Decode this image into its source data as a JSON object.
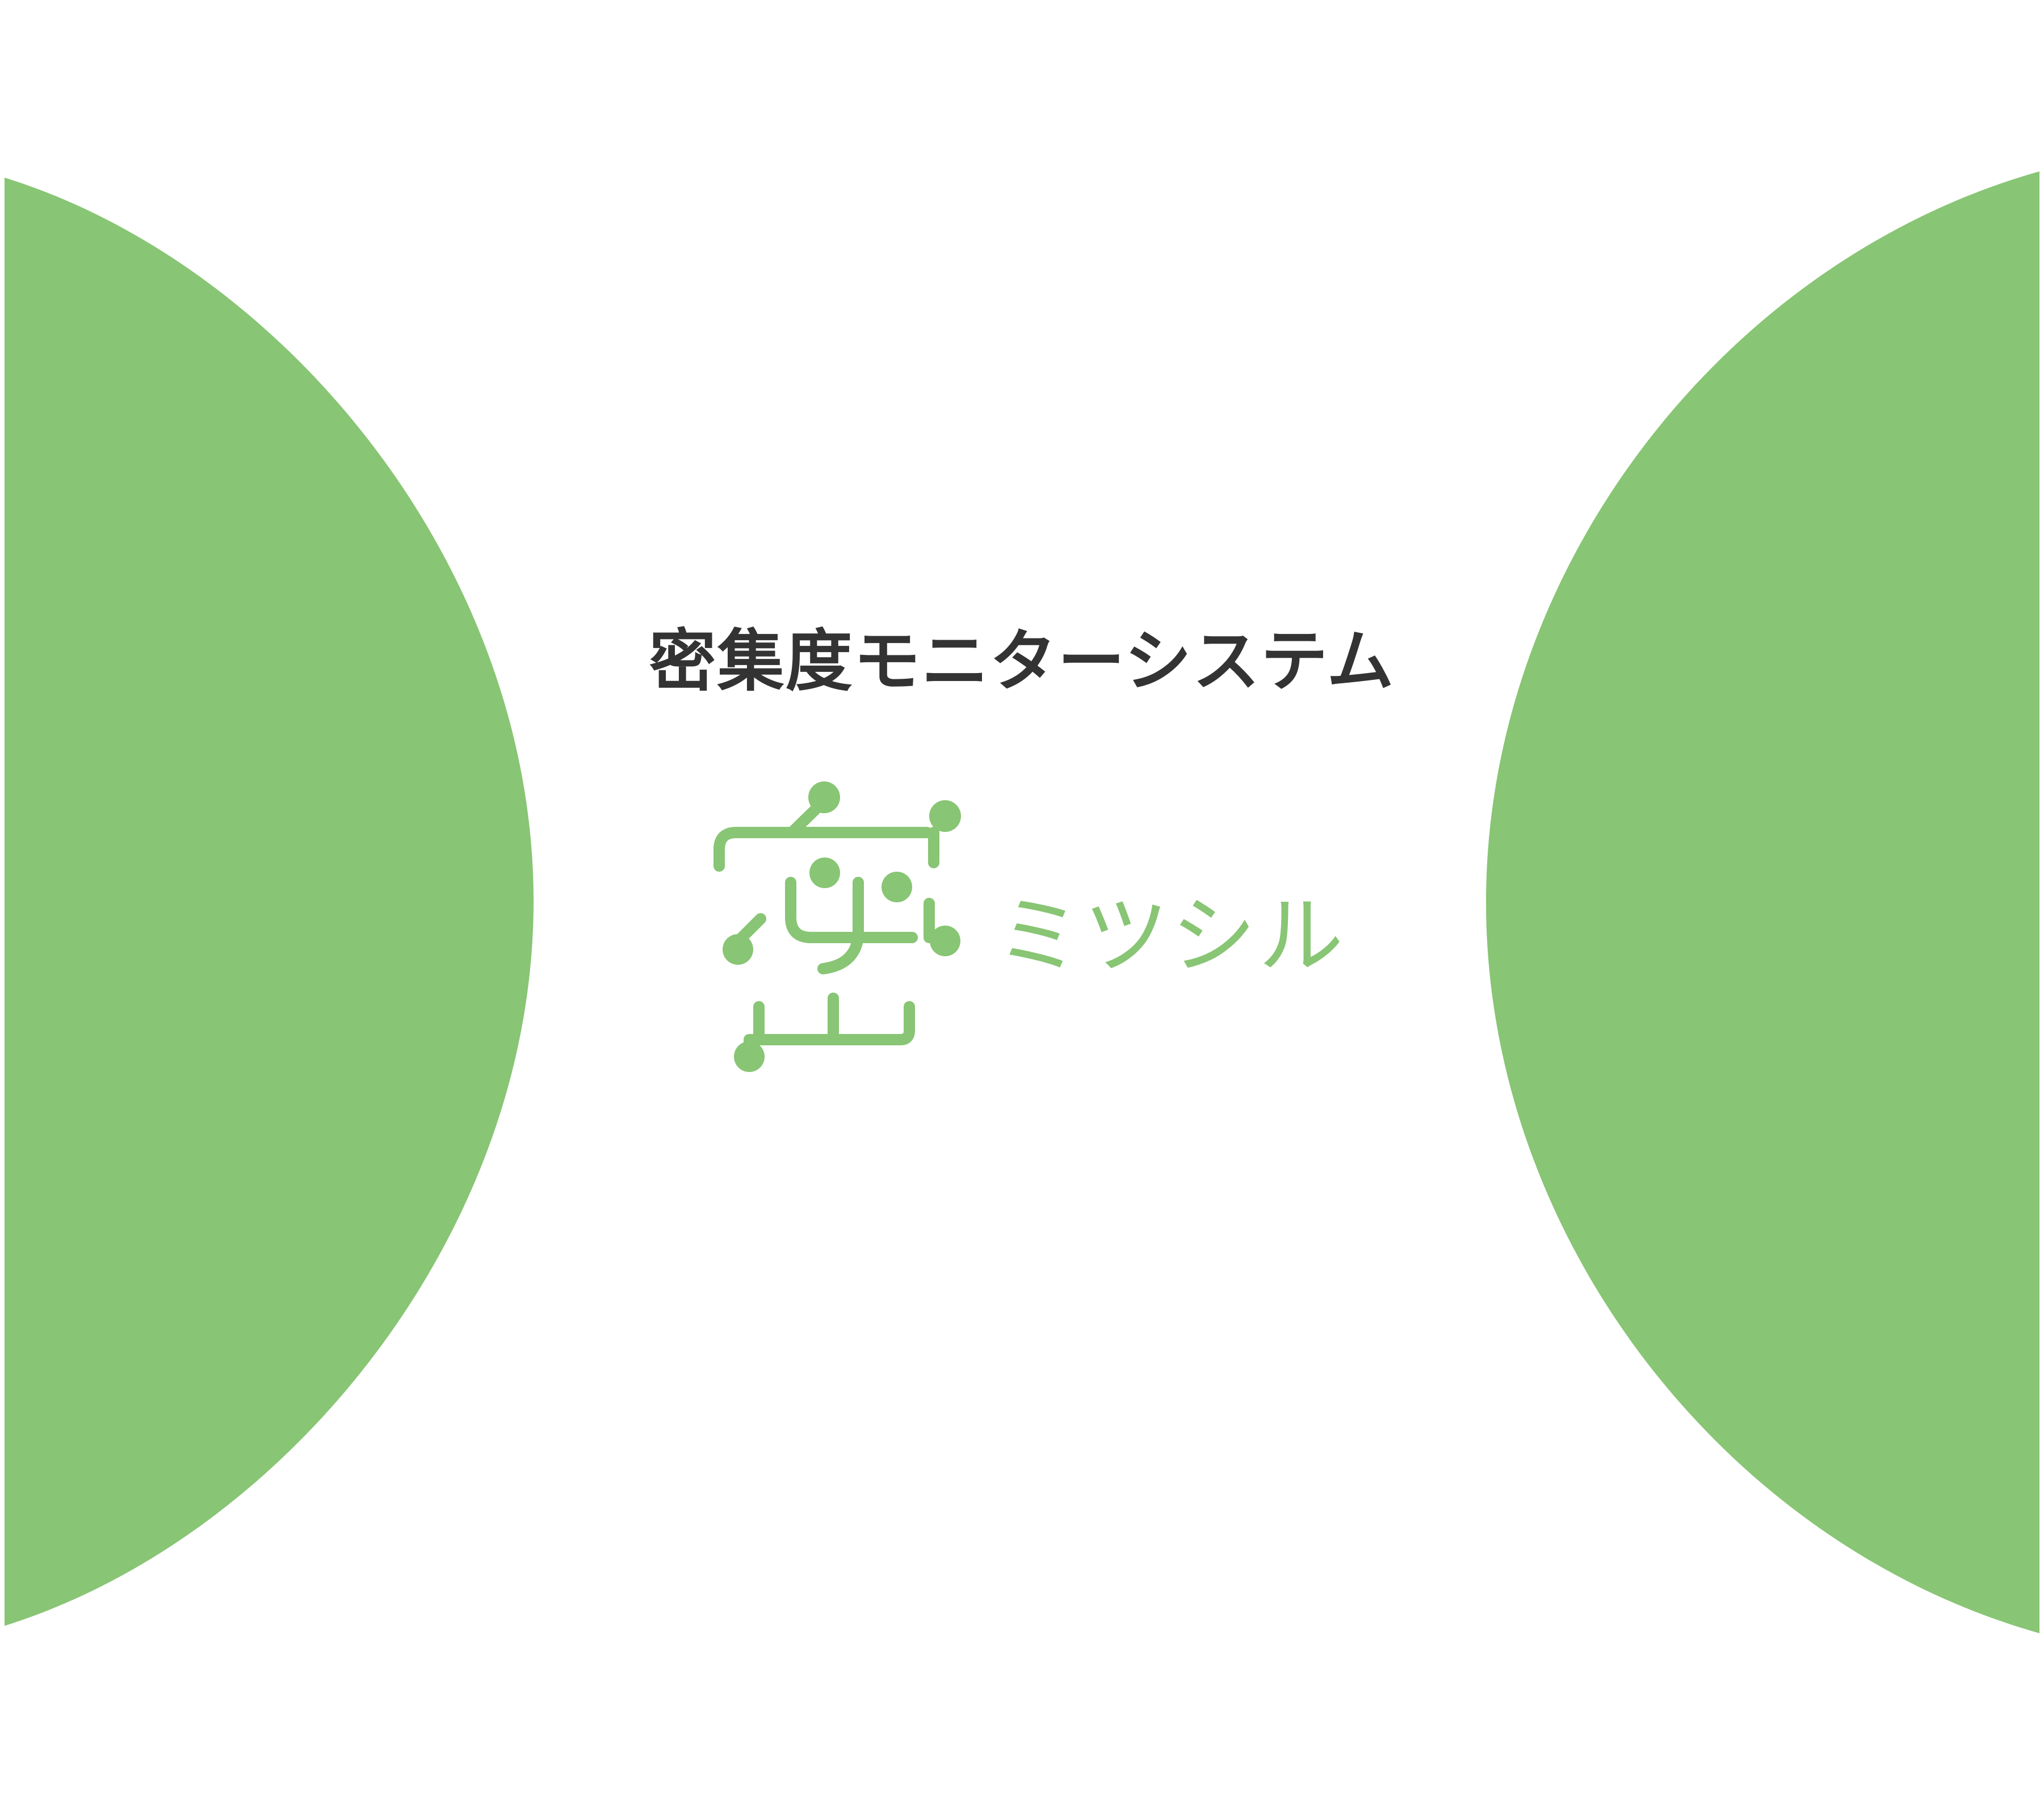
{
  "colors": {
    "accent": "#88c574",
    "text": "#333333",
    "background": "#ffffff"
  },
  "header": {
    "tagline": "密集度モニターシステム"
  },
  "logo": {
    "icon": "mitsuru-mark-icon",
    "brand_name": "ミツシル"
  }
}
